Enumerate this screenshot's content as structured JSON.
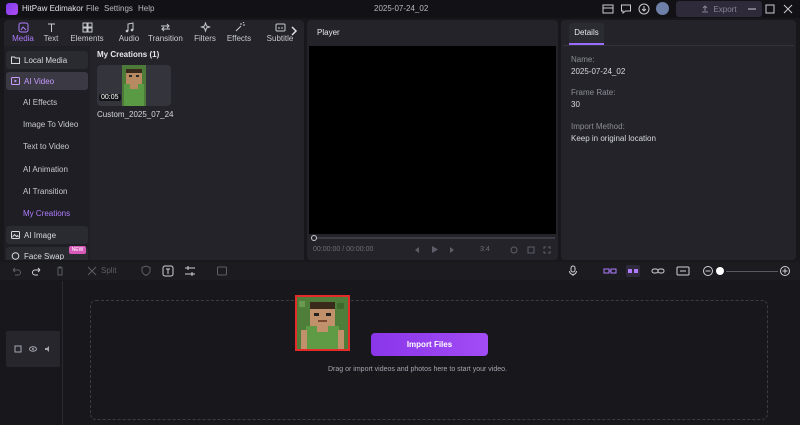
{
  "app": {
    "name": "HitPaw Edimakor",
    "project_title": "2025-07-24_02"
  },
  "menu": [
    "File",
    "Settings",
    "Help"
  ],
  "export_label": "Export",
  "tabs": [
    {
      "label": "Media",
      "icon": "media-icon",
      "active": true
    },
    {
      "label": "Text",
      "icon": "text-icon"
    },
    {
      "label": "Elements",
      "icon": "elements-icon"
    },
    {
      "label": "Audio",
      "icon": "audio-icon"
    },
    {
      "label": "Transition",
      "icon": "transition-icon"
    },
    {
      "label": "Filters",
      "icon": "filters-icon"
    },
    {
      "label": "Effects",
      "icon": "effects-icon"
    },
    {
      "label": "Subtitle",
      "icon": "subtitle-icon"
    }
  ],
  "sidebar": {
    "local_media": "Local Media",
    "ai_video": "AI Video",
    "ai_video_items": [
      "AI Effects",
      "Image To Video",
      "Text to Video",
      "AI Animation",
      "AI Transition",
      "My Creations"
    ],
    "ai_image": "AI Image",
    "face_swap": "Face Swap",
    "new_badge": "NEW"
  },
  "media": {
    "section_title": "My Creations (1)",
    "clips": [
      {
        "name": "Custom_2025_07_24",
        "duration": "00:05"
      }
    ]
  },
  "player": {
    "label": "Player",
    "current_time": "00:00:00",
    "separator": "/",
    "total_time": "00:00:00",
    "ratio": "3:4"
  },
  "details": {
    "tab": "Details",
    "fields": [
      {
        "label": "Name:",
        "value": "2025-07-24_02"
      },
      {
        "label": "Frame Rate:",
        "value": "30"
      },
      {
        "label": "Import Method:",
        "value": "Keep in original location"
      }
    ]
  },
  "toolbar": {
    "split_label": "Split"
  },
  "timeline": {
    "import_button": "Import Files",
    "hint": "Drag or import videos and photos here to start your video."
  },
  "colors": {
    "accent": "#A24CF5",
    "background": "#17171C",
    "panel": "#232329"
  }
}
